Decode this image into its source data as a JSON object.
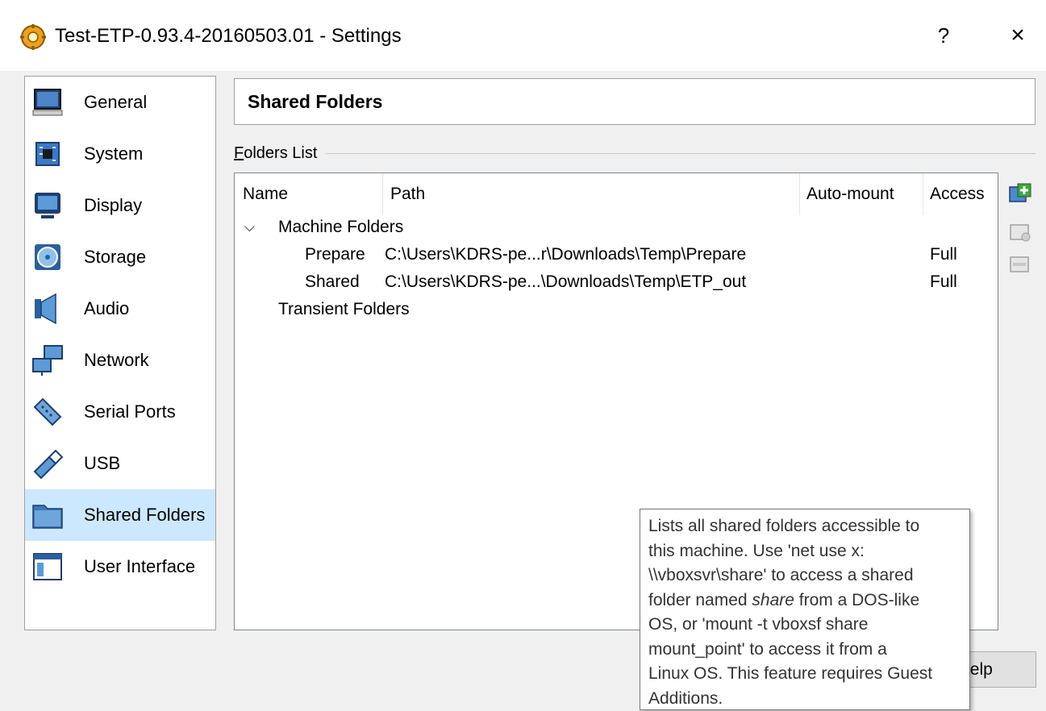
{
  "window": {
    "title": "Test-ETP-0.93.4-20160503.01 - Settings",
    "help_label": "?",
    "close_label": "×"
  },
  "sidebar": {
    "selected": "Shared Folders",
    "items": [
      {
        "label": "General",
        "icon": "monitor-icon"
      },
      {
        "label": "System",
        "icon": "chip-icon"
      },
      {
        "label": "Display",
        "icon": "display-icon"
      },
      {
        "label": "Storage",
        "icon": "disc-icon"
      },
      {
        "label": "Audio",
        "icon": "speaker-icon"
      },
      {
        "label": "Network",
        "icon": "network-icon"
      },
      {
        "label": "Serial Ports",
        "icon": "serial-port-icon"
      },
      {
        "label": "USB",
        "icon": "usb-icon"
      },
      {
        "label": "Shared Folders",
        "icon": "folder-icon"
      },
      {
        "label": "User Interface",
        "icon": "window-icon"
      }
    ]
  },
  "page": {
    "title": "Shared Folders",
    "group_label_first": "F",
    "group_label_rest": "olders List"
  },
  "table": {
    "columns": [
      "Name",
      "Path",
      "Auto-mount",
      "Access"
    ],
    "groups": [
      {
        "label": "Machine Folders",
        "expanded": true,
        "rows": [
          {
            "name": "Prepare",
            "path": "C:\\Users\\KDRS-pe...r\\Downloads\\Temp\\Prepare",
            "auto_mount": "",
            "access": "Full"
          },
          {
            "name": "Shared",
            "path": "C:\\Users\\KDRS-pe...\\Downloads\\Temp\\ETP_out",
            "auto_mount": "",
            "access": "Full"
          }
        ]
      },
      {
        "label": "Transient Folders",
        "expanded": false,
        "rows": []
      }
    ]
  },
  "tools": [
    "add-folder-icon",
    "edit-folder-icon",
    "remove-folder-icon"
  ],
  "buttons": {
    "help_label": "Help",
    "help_visible": "lelp"
  },
  "tooltip": {
    "line1": "Lists all shared folders accessible to",
    "line2": "this machine. Use 'net use x:",
    "line3": "\\\\vboxsvr\\share' to access a shared",
    "line4_pre": "folder named ",
    "line4_em": "share",
    "line4_post": " from a DOS-like",
    "line5": "OS, or 'mount -t vboxsf share",
    "line6": "mount_point' to access it from a",
    "line7": "Linux OS. This feature requires Guest",
    "line8": "Additions."
  },
  "colors": {
    "selection": "#cce8ff",
    "accent": "#3c78b4",
    "add_icon": "#3fa73f"
  }
}
